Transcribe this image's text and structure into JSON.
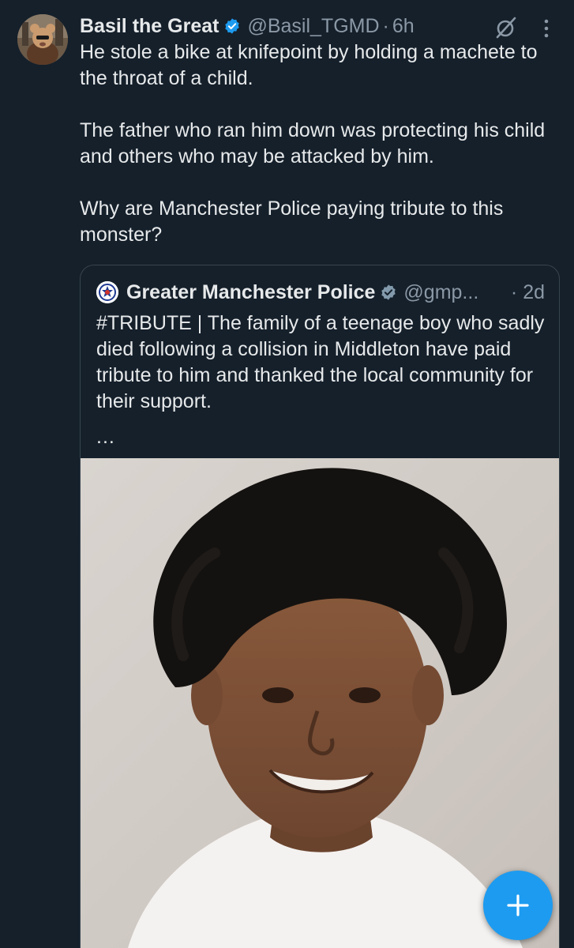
{
  "tweet": {
    "author_name": "Basil the Great",
    "handle": "@Basil_TGMD",
    "separator": "·",
    "time": "6h",
    "paragraphs": [
      "He stole a bike at knifepoint by holding a machete to the throat of a child.",
      "The father who ran him down was protecting his child and others who may be attacked by him.",
      "Why are Manchester Police paying tribute to this monster?"
    ]
  },
  "quote": {
    "author_name": "Greater Manchester Police",
    "handle": "@gmp...",
    "separator": "·",
    "time": "2d",
    "text": "#TRIBUTE | The family of a teenage boy who sadly died following a collision in Middleton have paid tribute to him and thanked the local community for their support.",
    "more": "..."
  },
  "icons": {
    "verified": "verified-badge-icon",
    "grok": "grok-icon",
    "more": "more-vertical-icon",
    "compose": "plus-icon"
  },
  "colors": {
    "background": "#15202b",
    "accent": "#1d9bf0",
    "text_primary": "#e7e9ea",
    "text_secondary": "#8b98a5",
    "border": "#38444d"
  }
}
